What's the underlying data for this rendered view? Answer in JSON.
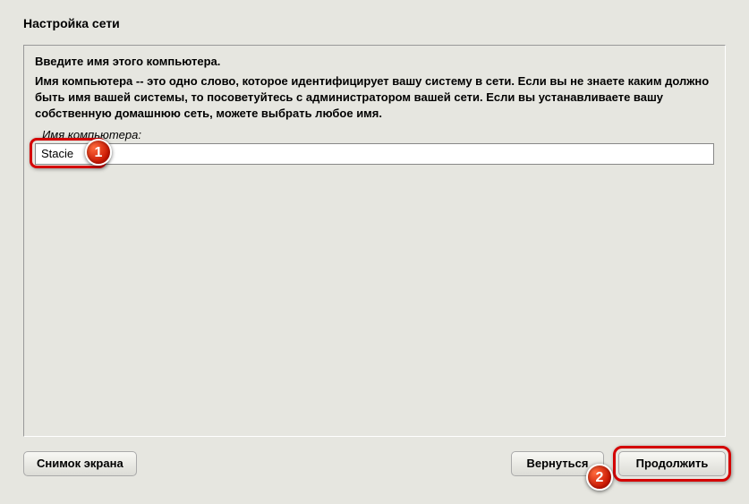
{
  "window": {
    "title": "Настройка сети"
  },
  "content": {
    "prompt": "Введите имя этого компьютера.",
    "description": "Имя компьютера -- это одно слово, которое идентифицирует вашу систему в сети. Если вы не знаете каким должно быть имя вашей системы, то посоветуйтесь с администратором вашей сети. Если вы устанавливаете вашу собственную домашнюю сеть, можете выбрать любое имя.",
    "field_label": "Имя компьютера:",
    "hostname_value": "Stacie"
  },
  "buttons": {
    "screenshot": "Снимок экрана",
    "back": "Вернуться",
    "continue": "Продолжить"
  },
  "annotations": {
    "badge1": "1",
    "badge2": "2"
  }
}
